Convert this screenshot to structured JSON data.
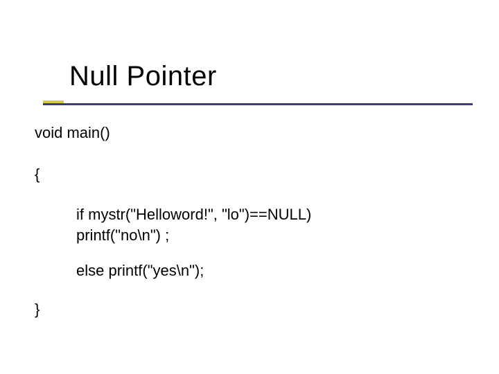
{
  "title": "Null Pointer",
  "code": {
    "signature": "void main()",
    "open_brace": "{",
    "if_line": "if mystr(\"Helloword!\", \"lo\")==NULL)",
    "printf_no": "printf(\"no\\n\") ;",
    "else_line": "else printf(\"yes\\n\");",
    "close_brace": "}"
  },
  "colors": {
    "accent_yellow": "#d9cc3a",
    "accent_purple": "#3e3a7a",
    "text": "#000000",
    "background": "#ffffff"
  }
}
